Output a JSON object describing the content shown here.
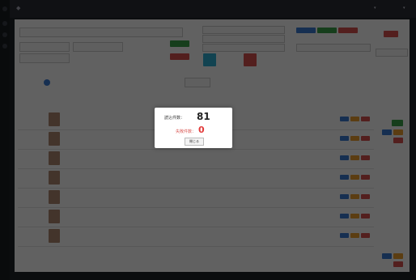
{
  "modal": {
    "success_label": "読込件数：",
    "success_count": "81",
    "failed_label": "失敗件数：",
    "failed_count": "0",
    "close_label": "閉じる"
  },
  "colors": {
    "success": "#222222",
    "failed": "#e23b3b",
    "accent_green": "#3aa34a",
    "accent_red": "#d9534f",
    "accent_blue": "#3a7bd5"
  }
}
